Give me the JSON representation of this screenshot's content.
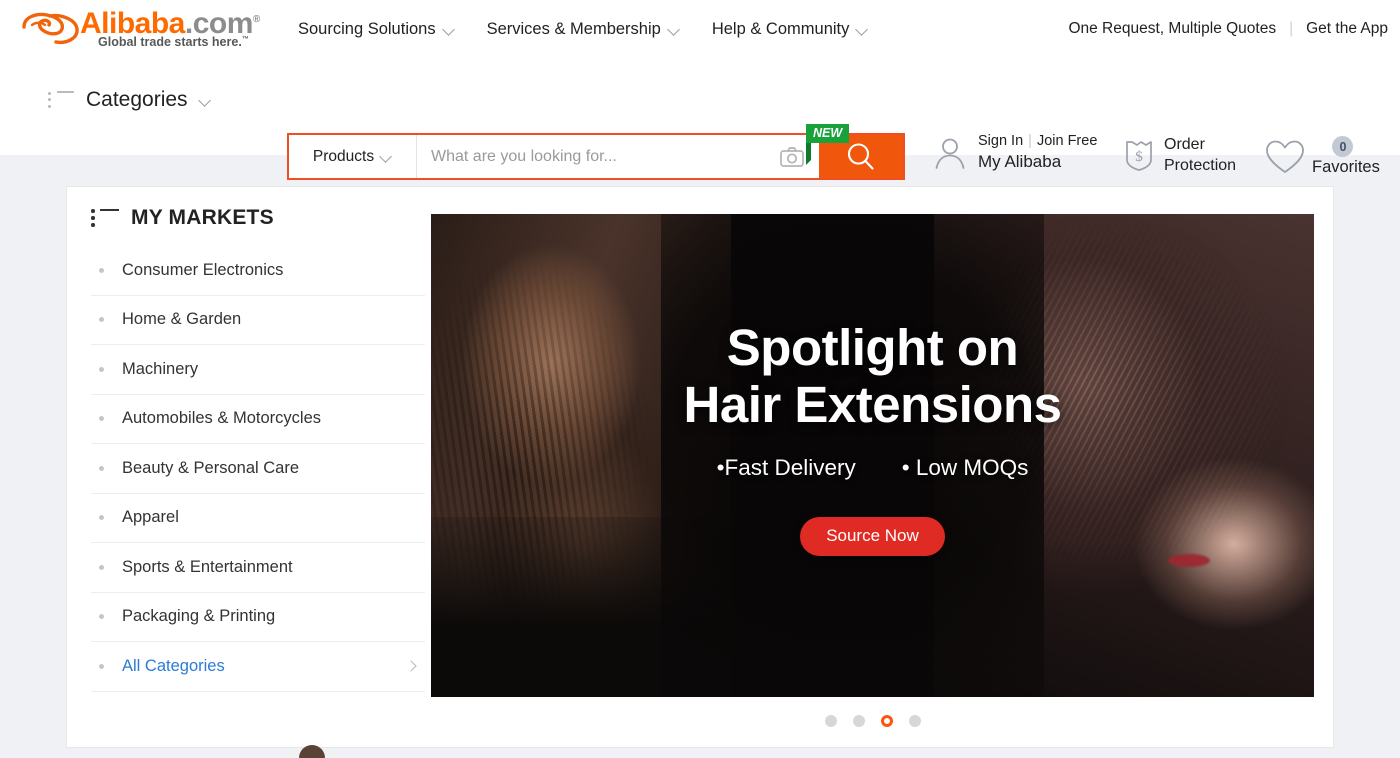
{
  "header": {
    "logo": {
      "brand": "Alibaba",
      "domain": ".com",
      "registered": "®",
      "tagline": "Global trade starts here.",
      "tm": "™"
    },
    "nav": [
      {
        "label": "Sourcing Solutions",
        "icon": "chevron-down-icon"
      },
      {
        "label": "Services & Membership",
        "icon": "chevron-down-icon"
      },
      {
        "label": "Help & Community",
        "icon": "chevron-down-icon"
      }
    ],
    "utility": {
      "one_request": "One Request, Multiple Quotes",
      "separator": "|",
      "get_app": "Get the App"
    },
    "categories": {
      "label": "Categories",
      "icon": "list-icon"
    },
    "search": {
      "scope_label": "Products",
      "scope_icon": "chevron-down-icon",
      "placeholder": "What are you looking for...",
      "value": "",
      "camera_icon": "camera-icon",
      "search_icon": "search-icon",
      "new_badge": "NEW",
      "border_color": "#f04e23",
      "button_color": "#f0560c",
      "badge_color": "#19a13c"
    },
    "account": {
      "icon": "user-icon",
      "sign_in": "Sign In",
      "divider": "|",
      "join_free": "Join Free",
      "my_alibaba": "My Alibaba"
    },
    "order_protection": {
      "icon": "shield-dollar-icon",
      "line1": "Order",
      "line2": "Protection"
    },
    "favorites": {
      "icon": "heart-icon",
      "count": "0",
      "label": "Favorites"
    }
  },
  "sidebar": {
    "title": "MY MARKETS",
    "title_icon": "list-icon",
    "items": [
      {
        "label": "Consumer Electronics"
      },
      {
        "label": "Home & Garden"
      },
      {
        "label": "Machinery"
      },
      {
        "label": "Automobiles & Motorcycles"
      },
      {
        "label": "Beauty & Personal Care"
      },
      {
        "label": "Apparel"
      },
      {
        "label": "Sports & Entertainment"
      },
      {
        "label": "Packaging & Printing"
      }
    ],
    "all_categories": {
      "label": "All Categories",
      "icon": "chevron-right-icon",
      "color": "#2d7bd4"
    }
  },
  "banner": {
    "title_line1": "Spotlight on",
    "title_line2": "Hair Extensions",
    "feature1": "•Fast Delivery",
    "feature2": "• Low MOQs",
    "cta": "Source Now",
    "cta_color": "#e02b24",
    "carousel": {
      "total": 4,
      "active_index": 2,
      "active_color": "#ff5410",
      "inactive_color": "#d7d7d7"
    }
  },
  "colors": {
    "brand_orange": "#ff6a00",
    "page_background": "#eff1f5",
    "card_background": "#ffffff",
    "link_blue": "#2d7bd4"
  }
}
